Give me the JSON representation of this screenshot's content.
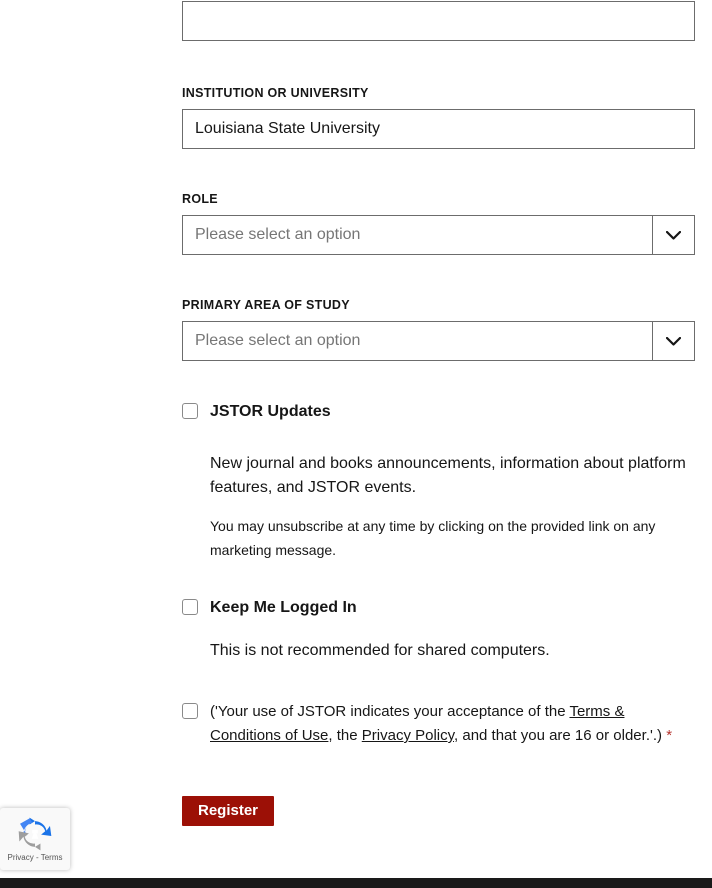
{
  "form": {
    "fields": [
      {
        "id": "previous-field",
        "label": "",
        "value": "",
        "placeholder": ""
      },
      {
        "id": "institution",
        "label": "INSTITUTION OR UNIVERSITY",
        "value": "Louisiana State University",
        "placeholder": ""
      },
      {
        "id": "role",
        "label": "ROLE",
        "value": "Please select an option",
        "arrow_icon": "chevron-down-icon"
      },
      {
        "id": "primary-area-of-study",
        "label": "PRIMARY AREA OF STUDY",
        "value": "Please select an option",
        "arrow_icon": "chevron-down-icon"
      }
    ],
    "jstor_updates": {
      "label": "JSTOR Updates",
      "checked": false,
      "description": "New journal and books announcements, information about platform features, and JSTOR events.",
      "unsubscribe_note": "You may unsubscribe at any time by clicking on the provided link on any marketing message."
    },
    "keep_logged_in": {
      "label": "Keep Me Logged In",
      "checked": false,
      "description": "This is not recommended for shared computers."
    },
    "terms": {
      "checked": false,
      "text_before_link1": "('Your use of JSTOR indicates your acceptance of the ",
      "link1": "Terms & Conditions of Use",
      "text_between": ", the ",
      "link2": "Privacy Policy",
      "text_after": ", and that you are 16 or older.'.)",
      "required_marker": "*"
    },
    "submit": {
      "label": "Register"
    }
  },
  "recaptcha": {
    "privacy_label": "Privacy",
    "separator": "-",
    "terms_label": "Terms",
    "logo_icon": "recaptcha-logo-icon"
  },
  "colors": {
    "register_button": "#9c1006",
    "required_asterisk": "#b5332e",
    "input_border": "#6c6c6c",
    "placeholder_text": "#767676",
    "footer_bar": "#1a1a1a"
  }
}
